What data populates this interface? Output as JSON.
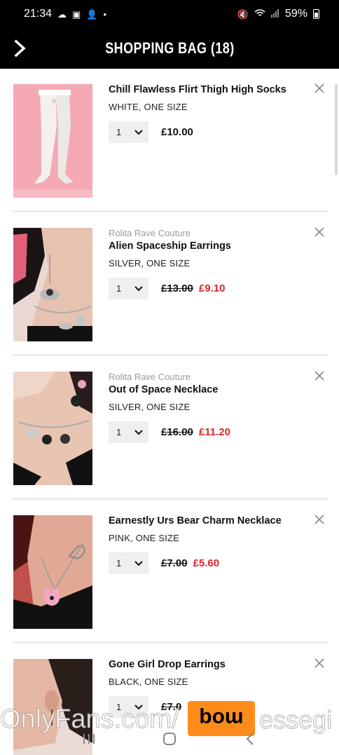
{
  "status_bar": {
    "time": "21:34",
    "battery": "59%",
    "left_icons": [
      "cloud-icon",
      "twitch-icon",
      "person-icon",
      "dot-icon"
    ],
    "right_icons": [
      "mute-icon",
      "wifi-icon",
      "signal-icon",
      "battery-icon"
    ]
  },
  "header": {
    "title": "SHOPPING BAG (18)",
    "back_icon": "chevron-right-icon"
  },
  "items": [
    {
      "brand": "",
      "name": "Chill Flawless Flirt Thigh High Socks",
      "variant": "WHITE, ONE SIZE",
      "qty": "1",
      "price": "£10.00",
      "sale_price": ""
    },
    {
      "brand": "Rolita Rave Couture",
      "name": "Alien Spaceship Earrings",
      "variant": "SILVER, ONE SIZE",
      "qty": "1",
      "price": "£13.00",
      "sale_price": "£9.10"
    },
    {
      "brand": "Rolita Rave Couture",
      "name": "Out of Space Necklace",
      "variant": "SILVER, ONE SIZE",
      "qty": "1",
      "price": "£16.00",
      "sale_price": "£11.20"
    },
    {
      "brand": "",
      "name": "Earnestly Urs Bear Charm Necklace",
      "variant": "PINK, ONE SIZE",
      "qty": "1",
      "price": "£7.00",
      "sale_price": "£5.60"
    },
    {
      "brand": "",
      "name": "Gone Girl Drop Earrings",
      "variant": "BLACK, ONE SIZE",
      "qty": "1",
      "price": "£7.0",
      "sale_price": ""
    }
  ],
  "watermark": {
    "text": "OnlyFans.com/",
    "logo": "moq",
    "tail": "essegi"
  },
  "colors": {
    "header_bg": "#000000",
    "sale_red": "#e0242b",
    "brand_grey": "#9a9a9a",
    "qty_bg": "#efefef",
    "watermark_orange": "#ff8c1a"
  }
}
